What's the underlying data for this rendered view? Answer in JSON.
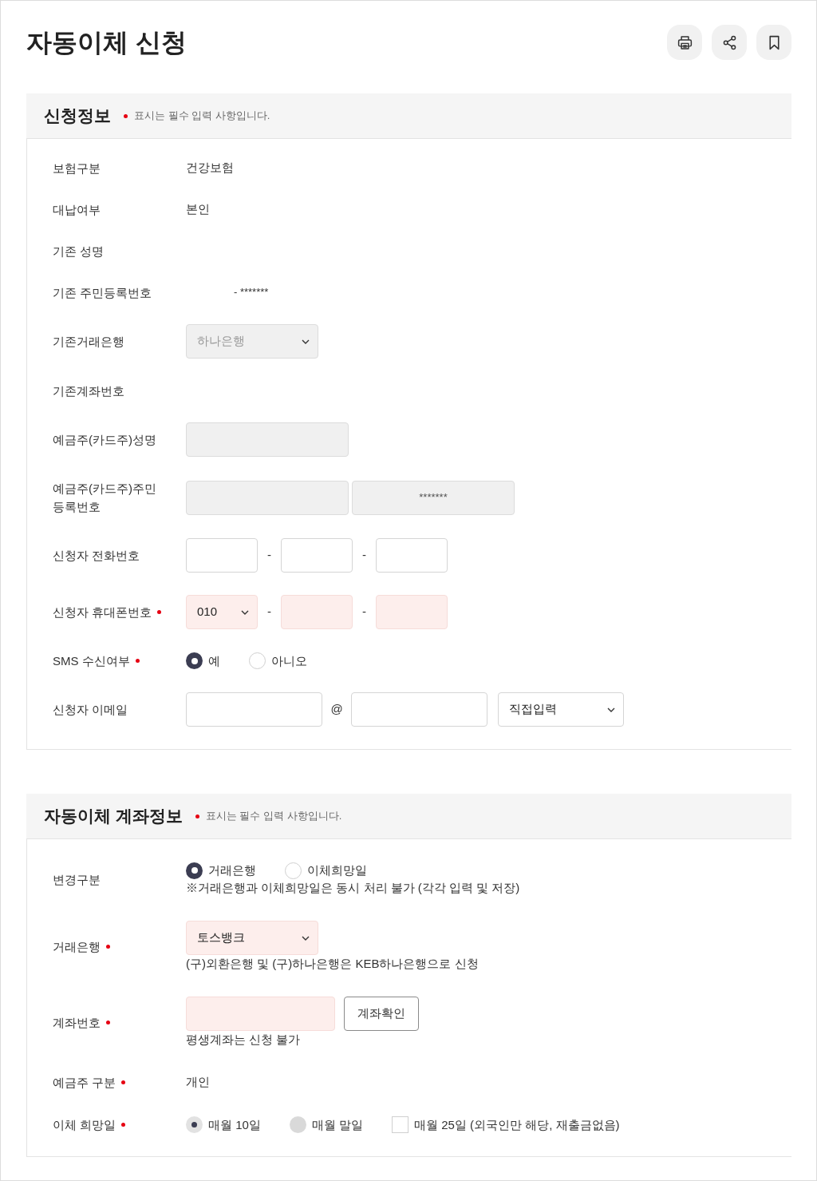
{
  "page": {
    "title": "자동이체 신청"
  },
  "sections": [
    {
      "title": "신청정보",
      "required_note": "표시는 필수 입력 사항입니다.",
      "rows": [
        {
          "label": "보험구분",
          "required": false,
          "kind": "text",
          "value": "건강보험"
        },
        {
          "label": "대납여부",
          "required": false,
          "kind": "text",
          "value": "본인"
        },
        {
          "label": "기존 성명",
          "required": false,
          "kind": "text"
        },
        {
          "label": "기존 주민등록번호",
          "required": false,
          "kind": "id_text",
          "value": "- *******"
        },
        {
          "label": "기존거래은행",
          "required": false,
          "kind": "bank",
          "parts": [
            {
              "kind": "select",
              "value": "하나은행",
              "disabled": true
            }
          ]
        },
        {
          "label": "기존계좌번호",
          "required": false,
          "kind": "text"
        },
        {
          "label": "예금주(카드주)성명",
          "required": false,
          "kind": "name",
          "parts": [
            {
              "kind": "input",
              "disabled": true
            }
          ]
        },
        {
          "label": "예금주(카드주)주민등록번호",
          "required": false,
          "kind": "id_number",
          "parts": [
            {
              "kind": "input",
              "disabled": true
            },
            {
              "kind": "input",
              "value": "*******",
              "disabled": true
            }
          ]
        },
        {
          "label": "신청자 전화번호",
          "required": false,
          "kind": "phone",
          "parts": [
            {
              "kind": "input",
              "disabled": false
            },
            {
              "kind": "separator",
              "text": "-"
            },
            {
              "kind": "input",
              "disabled": false
            },
            {
              "kind": "separator",
              "text": "-"
            },
            {
              "kind": "input",
              "disabled": false
            }
          ]
        },
        {
          "label": "신청자 휴대폰번호",
          "required": true,
          "kind": "phone",
          "parts": [
            {
              "kind": "select",
              "value": "010",
              "disabled": false
            },
            {
              "kind": "separator",
              "text": "-"
            },
            {
              "kind": "input",
              "disabled": false
            },
            {
              "kind": "separator",
              "text": "-"
            },
            {
              "kind": "input",
              "disabled": false
            }
          ]
        },
        {
          "label": "SMS 수신여부",
          "required": true,
          "kind": "choices",
          "options": [
            {
              "kind": "radio",
              "label": "예",
              "selected": true,
              "disabled": false
            },
            {
              "kind": "radio",
              "label": "아니오",
              "selected": false,
              "disabled": false
            }
          ]
        },
        {
          "label": "신청자 이메일",
          "required": false,
          "kind": "email",
          "parts": [
            {
              "kind": "input",
              "disabled": false
            },
            {
              "kind": "separator",
              "text": "@"
            },
            {
              "kind": "input",
              "disabled": false
            },
            {
              "kind": "select",
              "value": "직접입력",
              "disabled": false
            }
          ]
        }
      ]
    },
    {
      "title": "자동이체 계좌정보",
      "required_note": "표시는 필수 입력 사항입니다.",
      "rows": [
        {
          "label": "변경구분",
          "required": false,
          "kind": "choices",
          "options": [
            {
              "kind": "radio",
              "label": "거래은행",
              "selected": true,
              "disabled": false
            },
            {
              "kind": "radio",
              "label": "이체희망일",
              "selected": false,
              "disabled": false
            }
          ],
          "note": "※거래은행과 이체희망일은 동시 처리 불가 (각각 입력 및 저장)"
        },
        {
          "label": "거래은행",
          "required": true,
          "kind": "bank",
          "parts": [
            {
              "kind": "select",
              "value": "토스뱅크",
              "disabled": false
            }
          ],
          "note": "(구)외환은행 및 (구)하나은행은 KEB하나은행으로 신청"
        },
        {
          "label": "계좌번호",
          "required": true,
          "kind": "account",
          "parts": [
            {
              "kind": "input",
              "disabled": false
            },
            {
              "kind": "button",
              "text": "계좌확인"
            }
          ],
          "note": "평생계좌는 신청 불가"
        },
        {
          "label": "예금주 구분",
          "required": true,
          "kind": "text",
          "value": "개인"
        },
        {
          "label": "이체 희망일",
          "required": true,
          "kind": "choices",
          "options": [
            {
              "kind": "radio",
              "label": "매월 10일",
              "selected": true,
              "disabled": true
            },
            {
              "kind": "radio",
              "label": "매월 말일",
              "selected": false,
              "disabled": true
            },
            {
              "kind": "checkbox",
              "label": "매월 25일 (외국인만 해당, 재출금없음)",
              "checked": false
            }
          ]
        }
      ]
    }
  ]
}
